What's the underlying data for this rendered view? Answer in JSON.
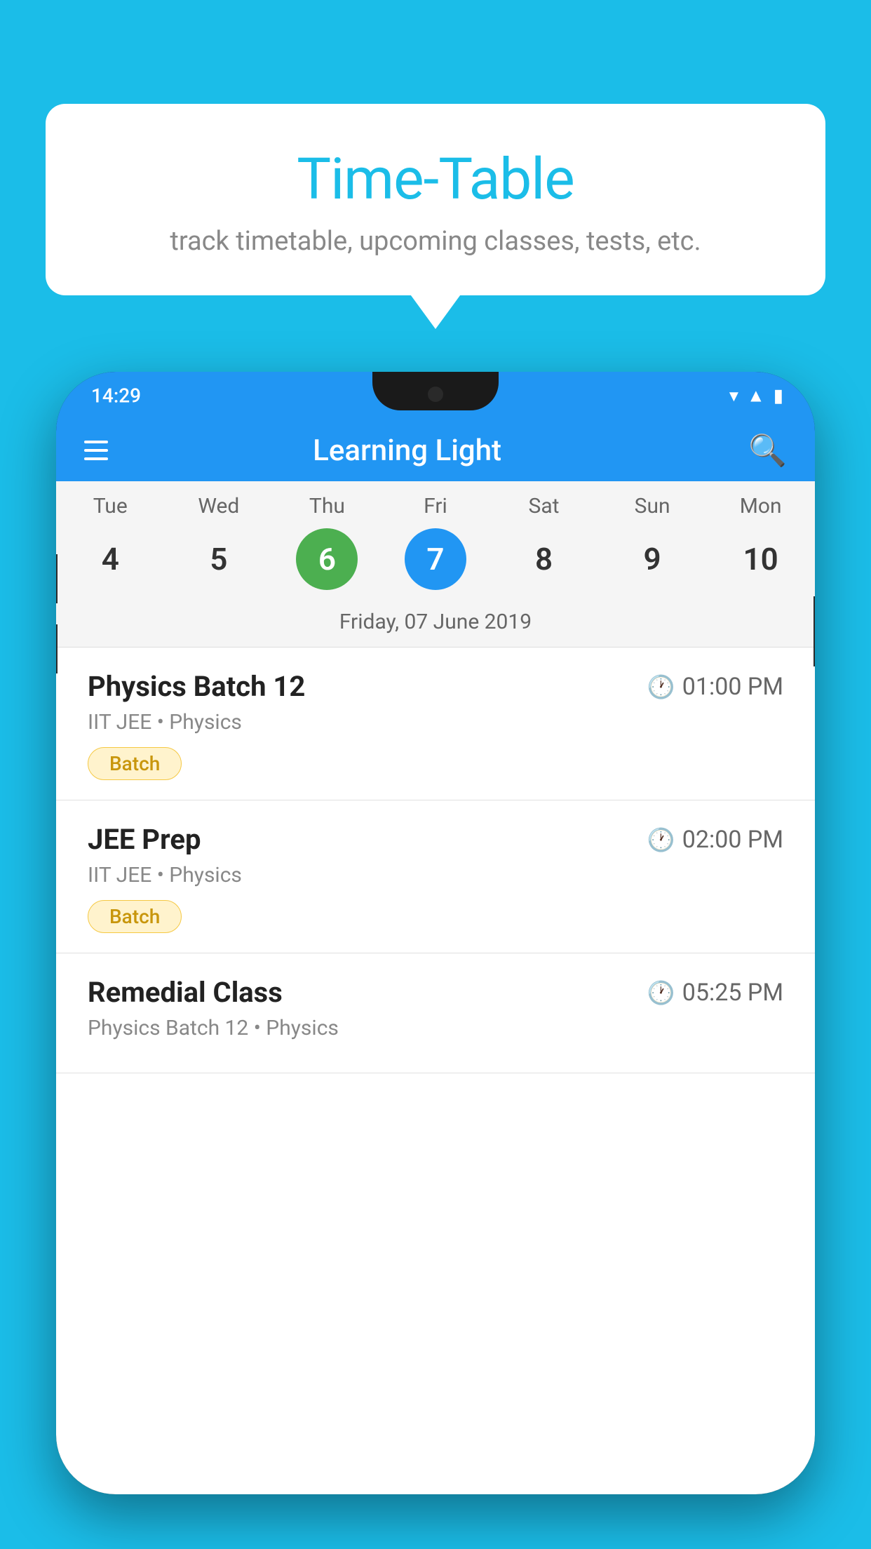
{
  "background_color": "#1BBDE8",
  "bubble": {
    "title": "Time-Table",
    "subtitle": "track timetable, upcoming classes, tests, etc."
  },
  "app": {
    "name": "Learning Light",
    "status_time": "14:29"
  },
  "calendar": {
    "days": [
      "Tue",
      "Wed",
      "Thu",
      "Fri",
      "Sat",
      "Sun",
      "Mon"
    ],
    "dates": [
      "4",
      "5",
      "6",
      "7",
      "8",
      "9",
      "10"
    ],
    "today_index": 2,
    "selected_index": 3,
    "selected_label": "Friday, 07 June 2019"
  },
  "schedule": [
    {
      "title": "Physics Batch 12",
      "time": "01:00 PM",
      "subtitle": "IIT JEE • Physics",
      "badge": "Batch"
    },
    {
      "title": "JEE Prep",
      "time": "02:00 PM",
      "subtitle": "IIT JEE • Physics",
      "badge": "Batch"
    },
    {
      "title": "Remedial Class",
      "time": "05:25 PM",
      "subtitle": "Physics Batch 12 • Physics",
      "badge": null
    }
  ]
}
